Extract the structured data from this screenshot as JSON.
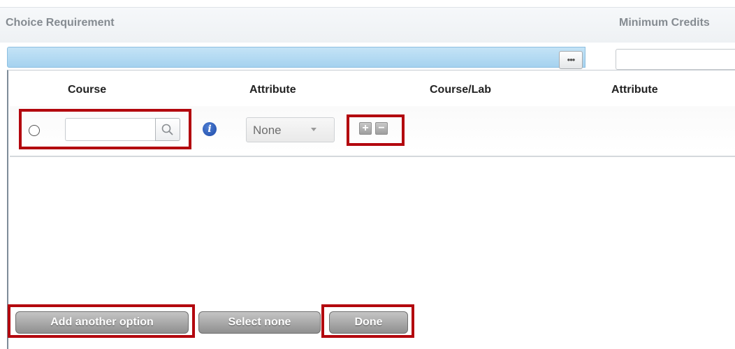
{
  "header": {
    "choice_requirement_label": "Choice Requirement",
    "minimum_credits_label": "Minimum Credits"
  },
  "requirement_bar": {
    "more_button_label": "•••"
  },
  "table": {
    "columns": [
      "Course",
      "Attribute",
      "Course/Lab",
      "Attribute"
    ],
    "row": {
      "course_value": "",
      "attribute_selected": "None",
      "add_label": "+",
      "remove_label": "−"
    }
  },
  "footer": {
    "add_option_label": "Add another option",
    "select_none_label": "Select none",
    "done_label": "Done"
  },
  "colors": {
    "highlight": "#b3070e",
    "bar_blue": "#a5d2ef",
    "button_gray": "#9a9a9a"
  },
  "icons": [
    "search-icon",
    "info-icon",
    "ellipsis-icon",
    "plus-icon",
    "minus-icon",
    "chevron-down-icon"
  ]
}
